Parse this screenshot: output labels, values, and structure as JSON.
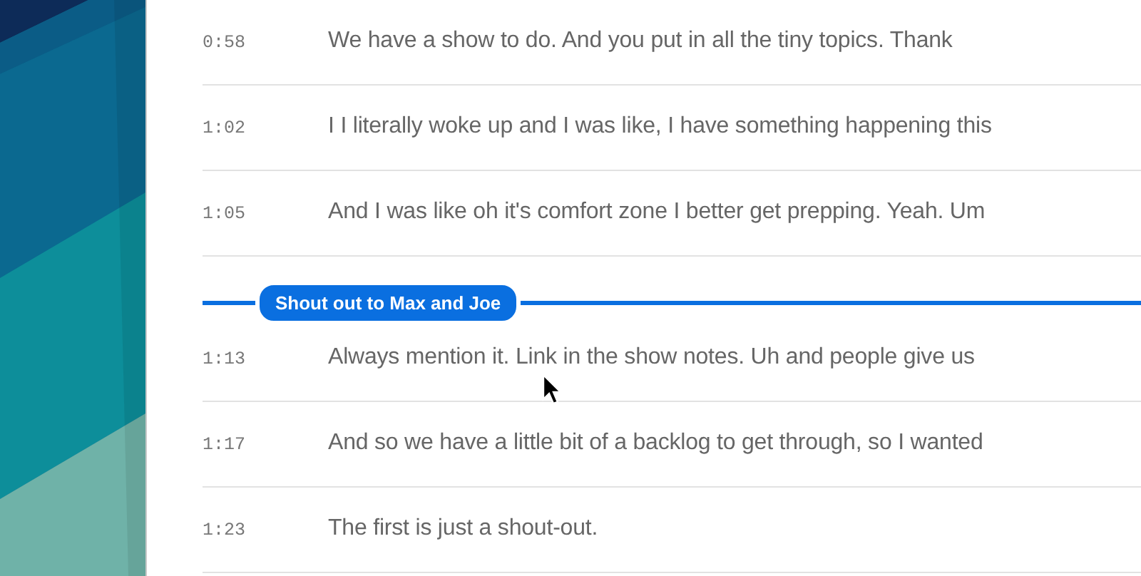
{
  "entries": [
    {
      "kind": "line",
      "time": "0:58",
      "text": "We have a show to do. And you put in all the tiny topics. Thank"
    },
    {
      "kind": "line",
      "time": "1:02",
      "text": "I I literally woke up and I was like, I have something happening this"
    },
    {
      "kind": "line",
      "time": "1:05",
      "text": "And I was like oh it's comfort zone I better get prepping. Yeah. Um"
    },
    {
      "kind": "chapter",
      "title": "Shout out to Max and Joe"
    },
    {
      "kind": "line",
      "time": "1:13",
      "text": "Always mention it. Link in the show notes. Uh and people give us"
    },
    {
      "kind": "line",
      "time": "1:17",
      "text": "And so we have a little bit of a backlog to get through, so I wanted"
    },
    {
      "kind": "line",
      "time": "1:23",
      "text": "The first is just a shout-out."
    }
  ]
}
